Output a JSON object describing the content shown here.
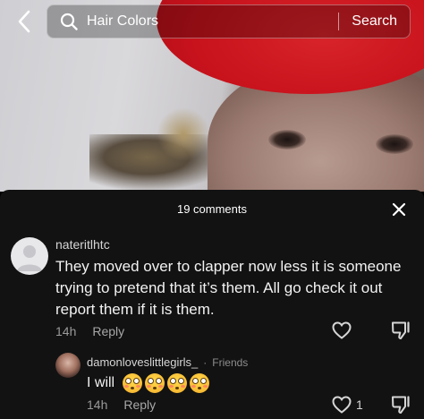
{
  "search": {
    "query": "Hair Colors",
    "button_label": "Search"
  },
  "icons": {
    "back": "chevron-left-icon",
    "search": "search-icon",
    "close": "close-icon",
    "like": "heart-icon",
    "dislike": "thumbs-down-icon",
    "emoji": "flushed-face-emoji"
  },
  "comments_sheet": {
    "header": "19 comments",
    "comments": [
      {
        "username": "nateritlhtc",
        "text": "They moved over to clapper now less it is someone trying to pretend that it’s them. All go check it out report them if it is them.",
        "time": "14h",
        "reply_label": "Reply",
        "like_count": ""
      }
    ],
    "reply": {
      "username": "damonloveslittlegirls_",
      "separator": "·",
      "relation": "Friends",
      "text": "I will",
      "emoji_count": 4,
      "time": "14h",
      "reply_label": "Reply",
      "like_count": "1"
    }
  },
  "colors": {
    "sheet_bg": "#121212",
    "cap_red": "#c8121c"
  }
}
